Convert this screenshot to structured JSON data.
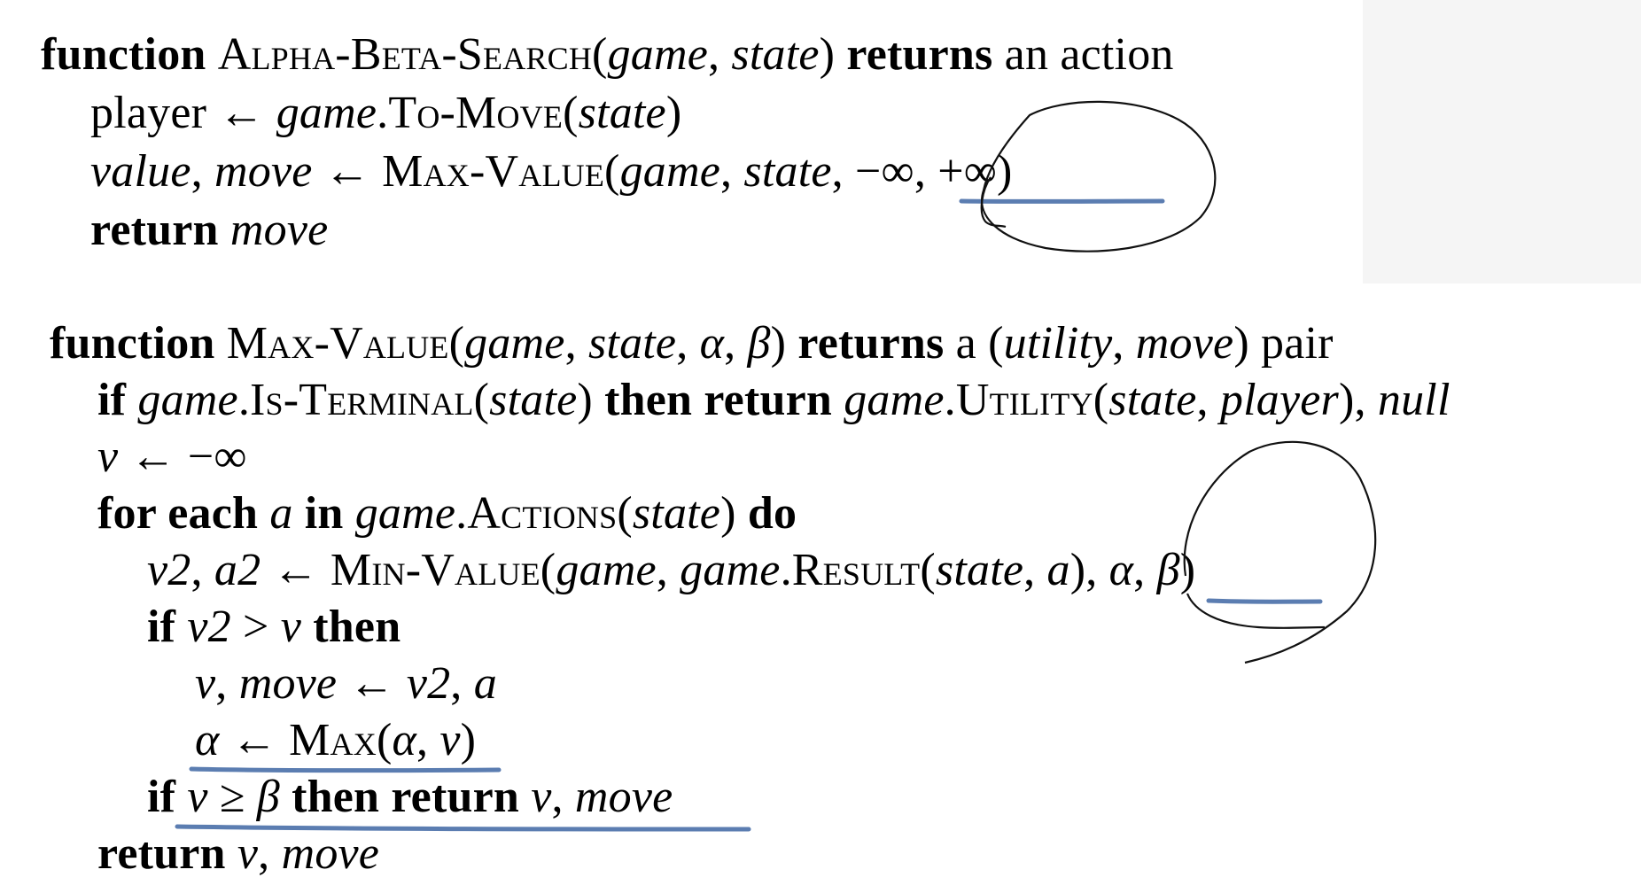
{
  "search_fn": {
    "l1_kw": "function",
    "l1_name": "Alpha-Beta-Search",
    "l1_open": "(",
    "l1_game": "game",
    "l1_comma": ", ",
    "l1_state": "state",
    "l1_close": ")",
    "l1_returns": "returns",
    "l1_tail": "an action",
    "l2_player": "player",
    "l2_arrow": " ← ",
    "l2_game": "game",
    "l2_dot": ".",
    "l2_fn": "To-Move",
    "l2_open": "(",
    "l2_state": "state",
    "l2_close": ")",
    "l3_value": "value",
    "l3_comma": ", ",
    "l3_move": "move",
    "l3_arrow": " ← ",
    "l3_fn": "Max-Value",
    "l3_open": "(",
    "l3_game": "game",
    "l3_comma2": ", ",
    "l3_state": "state",
    "l3_comma3": ", ",
    "l3_args": "−∞, +∞",
    "l3_close": ")",
    "l4_kw": "return",
    "l4_move": "move"
  },
  "max_fn": {
    "l1_kw": "function",
    "l1_name": "Max-Value",
    "l1_open": "(",
    "l1_game": "game",
    "l1_c1": ", ",
    "l1_state": "state",
    "l1_c2": ", ",
    "l1_alpha": "α",
    "l1_c3": ", ",
    "l1_beta": "β",
    "l1_close": ")",
    "l1_returns": "returns",
    "l1_a": "a (",
    "l1_utility": "utility",
    "l1_c4": ", ",
    "l1_move": "move",
    "l1_tail": ") pair",
    "l2_if": "if",
    "l2_game": "game",
    "l2_dot": ".",
    "l2_fn": "Is-Terminal",
    "l2_open": "(",
    "l2_state": "state",
    "l2_close": ")",
    "l2_then": "then return",
    "l2_game2": "game",
    "l2_dot2": ".",
    "l2_fn2": "Utility",
    "l2_open2": "(",
    "l2_state2": "state",
    "l2_c": ", ",
    "l2_player": "player",
    "l2_close2": "), ",
    "l2_null": "null",
    "l3_v": "v",
    "l3_rest": " ← −∞",
    "l4_for": "for each",
    "l4_a": "a",
    "l4_in": "in",
    "l4_game": "game",
    "l4_dot": ".",
    "l4_fn": "Actions",
    "l4_open": "(",
    "l4_state": "state",
    "l4_close": ")",
    "l4_do": "do",
    "l5_v2": "v2",
    "l5_c": ", ",
    "l5_a2": "a2",
    "l5_arrow": " ← ",
    "l5_fn": "Min-Value",
    "l5_open": "(",
    "l5_game": "game",
    "l5_c2": ", ",
    "l5_game2": "game",
    "l5_dot": ".",
    "l5_fn2": "Result",
    "l5_open2": "(",
    "l5_state": "state",
    "l5_c3": ", ",
    "l5_a": "a",
    "l5_close": ")",
    "l5_c4": ", ",
    "l5_alpha": "α",
    "l5_c5": ", ",
    "l5_beta": "β",
    "l5_close2": ")",
    "l6_if": "if",
    "l6_v2": "v2",
    "l6_gt": " > ",
    "l6_v": "v",
    "l6_then": "then",
    "l7_v": "v",
    "l7_c": ", ",
    "l7_move": "move",
    "l7_arrow": " ← ",
    "l7_v2": "v2",
    "l7_c2": ", ",
    "l7_a": "a",
    "l8_alpha": "α",
    "l8_arrow": " ← ",
    "l8_fn": "Max",
    "l8_open": "(",
    "l8_alpha2": "α",
    "l8_c": ", ",
    "l8_v": "v",
    "l8_close": ")",
    "l9_if": "if",
    "l9_v": "v",
    "l9_ge": " ≥ ",
    "l9_beta": "β",
    "l9_then": "then return",
    "l9_v2": "v",
    "l9_c": ", ",
    "l9_move": "move",
    "l10_kw": "return",
    "l10_v": "v",
    "l10_c": ", ",
    "l10_move": "move"
  },
  "colors": {
    "underline": "#5b7db1",
    "pen": "#111111"
  }
}
